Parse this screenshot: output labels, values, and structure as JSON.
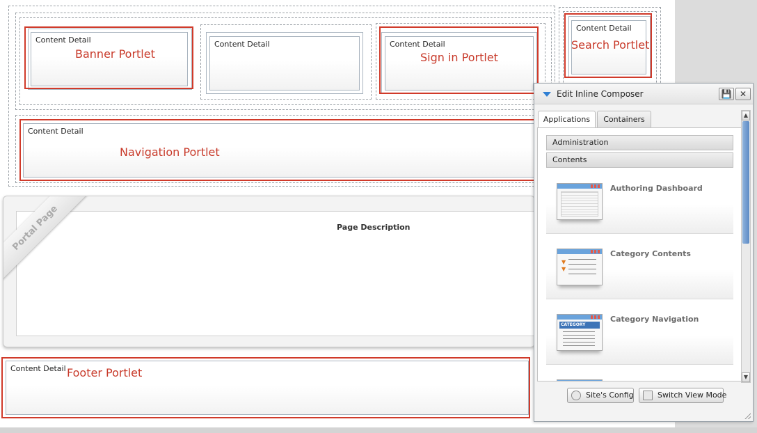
{
  "layout": {
    "portlets": {
      "banner": {
        "header": "Content Detail",
        "annotation": "Banner Portlet"
      },
      "empty": {
        "header": "Content Detail"
      },
      "signin": {
        "header": "Content Detail",
        "annotation": "Sign in Portlet"
      },
      "search": {
        "header": "Content Detail",
        "annotation": "Search Portlet"
      },
      "navigation": {
        "header": "Content Detail",
        "annotation": "Navigation Portlet"
      },
      "footer": {
        "header": "Content Detail",
        "annotation": "Footer Portlet"
      }
    },
    "portal_page": {
      "ribbon": "Portal Page",
      "description": "Page Description"
    }
  },
  "composer": {
    "title": "Edit Inline Composer",
    "tabs": [
      "Applications",
      "Containers"
    ],
    "categories": [
      "Administration",
      "Contents"
    ],
    "applications": [
      "Authoring Dashboard",
      "Category Contents",
      "Category Navigation"
    ],
    "thumb_text": "CATEGORY",
    "footer_buttons": {
      "site_config": "Site's Config",
      "switch_view": "Switch View Mode"
    }
  },
  "colors": {
    "annotation_red": "#d03a2a",
    "accent_blue": "#2f7fd3"
  }
}
